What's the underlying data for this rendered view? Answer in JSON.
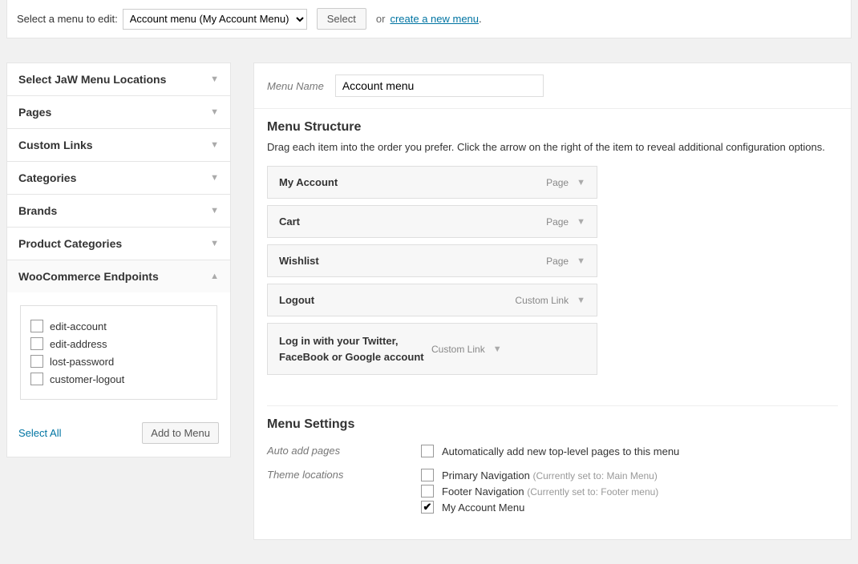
{
  "top": {
    "label": "Select a menu to edit:",
    "selected": "Account menu (My Account Menu)",
    "select_btn": "Select",
    "or": "or",
    "create_link": "create a new menu",
    "period": "."
  },
  "sidebar": {
    "panels": [
      {
        "title": "Select JaW Menu Locations",
        "open": false
      },
      {
        "title": "Pages",
        "open": false
      },
      {
        "title": "Custom Links",
        "open": false
      },
      {
        "title": "Categories",
        "open": false
      },
      {
        "title": "Brands",
        "open": false
      },
      {
        "title": "Product Categories",
        "open": false
      },
      {
        "title": "WooCommerce Endpoints",
        "open": true
      }
    ],
    "endpoints": [
      "edit-account",
      "edit-address",
      "lost-password",
      "customer-logout"
    ],
    "select_all": "Select All",
    "add_to_menu": "Add to Menu"
  },
  "menu": {
    "name_label": "Menu Name",
    "name_value": "Account menu",
    "structure_heading": "Menu Structure",
    "structure_hint": "Drag each item into the order you prefer. Click the arrow on the right of the item to reveal additional configuration options.",
    "items": [
      {
        "title": "My Account",
        "type": "Page"
      },
      {
        "title": "Cart",
        "type": "Page"
      },
      {
        "title": "Wishlist",
        "type": "Page"
      },
      {
        "title": "Logout",
        "type": "Custom Link"
      },
      {
        "title": "Log in with your Twitter, FaceBook or Google account",
        "type": "Custom Link"
      }
    ]
  },
  "settings": {
    "heading": "Menu Settings",
    "auto_pages_label": "Auto add pages",
    "auto_pages_cb": "Automatically add new top-level pages to this menu",
    "theme_locations_label": "Theme locations",
    "locations": [
      {
        "label": "Primary Navigation",
        "note": "(Currently set to: Main Menu)",
        "checked": false
      },
      {
        "label": "Footer Navigation",
        "note": "(Currently set to: Footer menu)",
        "checked": false
      },
      {
        "label": "My Account Menu",
        "note": "",
        "checked": true
      }
    ]
  }
}
